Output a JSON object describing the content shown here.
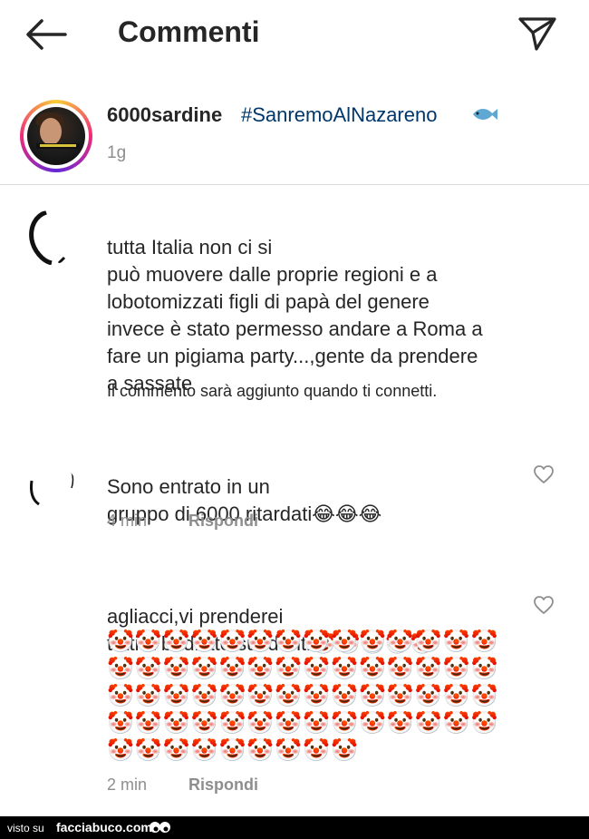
{
  "header": {
    "title": "Commenti"
  },
  "post": {
    "author": "6000sardine",
    "hashtag": "#SanremoAlNazareno",
    "time": "1g"
  },
  "comments": [
    {
      "text": "tutta Italia non ci si\npuò muovere dalle proprie regioni e a\nlobotomizzati figli di papà del genere\ninvece è stato permesso andare a Roma a\nfare un pigiama party...,gente da prendere\na sassate",
      "note": "Il commento sarà aggiunto quando ti connetti."
    },
    {
      "text": "Sono entrato in un\ngruppo di 6000 ritardati😂😂😂",
      "time": "4 min",
      "reply": "Rispondi"
    },
    {
      "text": "agliacci,vi prenderei\ntutti a badilate sui denti🤡🤡🤡🤡🤡",
      "clowns": "🤡🤡🤡🤡🤡🤡🤡🤡🤡🤡🤡🤡🤡🤡\n🤡🤡🤡🤡🤡🤡🤡🤡🤡🤡🤡🤡🤡🤡\n🤡🤡🤡🤡🤡🤡🤡🤡🤡🤡🤡🤡🤡🤡\n🤡🤡🤡🤡🤡🤡🤡🤡🤡🤡🤡🤡🤡🤡\n🤡🤡🤡🤡🤡🤡🤡🤡🤡",
      "time": "2 min",
      "reply": "Rispondi"
    }
  ],
  "footer": {
    "prefix": "visto su",
    "site": "facciabuco.com"
  },
  "icons": {
    "back": "arrow-left-icon",
    "send": "paper-plane-icon",
    "like": "heart-icon",
    "fish": "fish-emoji-icon",
    "footer_logo": "eyes-logo-icon"
  },
  "colors": {
    "hashtag": "#00376b",
    "secondary": "#8e8e8e",
    "divider": "#dbdbdb"
  }
}
